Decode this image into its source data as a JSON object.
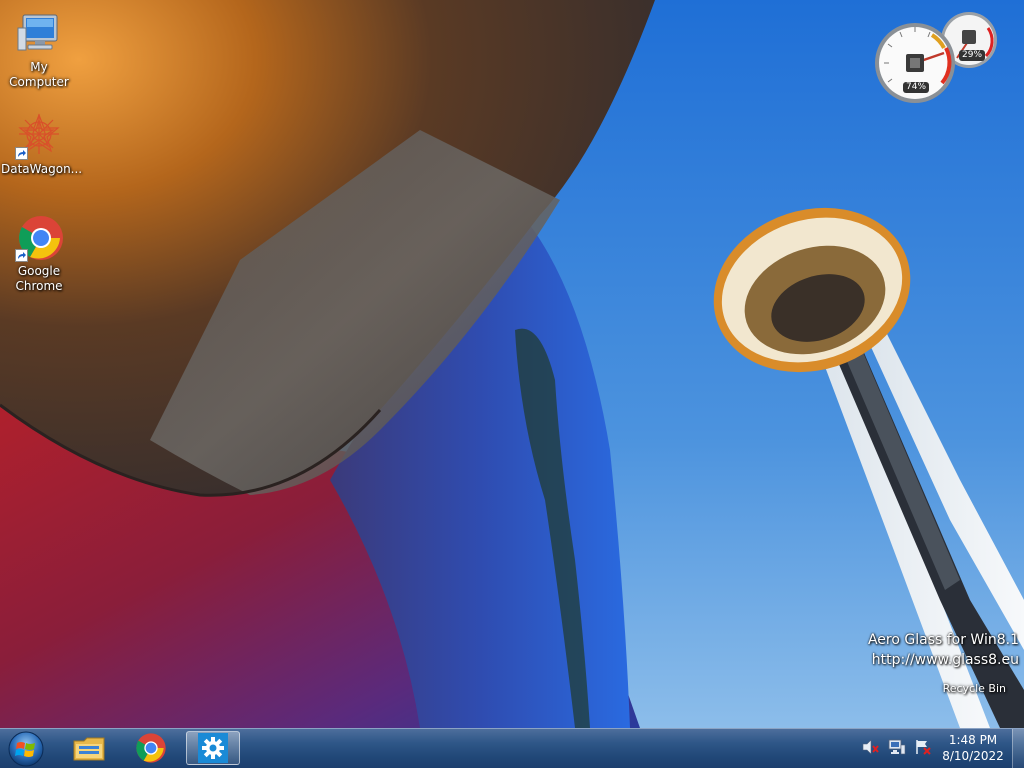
{
  "desktop": {
    "icons": [
      {
        "label": "My Computer",
        "icon": "computer-icon"
      },
      {
        "label": "DataWagon...",
        "icon": "datawagon-icon"
      },
      {
        "label": "Google Chrome",
        "icon": "chrome-icon"
      }
    ],
    "recycle_bin_label": "Recycle Bin"
  },
  "gadget": {
    "cpu_percent_label": "74%",
    "memory_percent_label": "29%",
    "cpu_usage": 0.74,
    "memory_usage": 0.29
  },
  "watermark": {
    "line1": "Aero Glass for Win8.1",
    "line2": "http://www.glass8.eu"
  },
  "taskbar": {
    "start_icon": "windows-start-orb",
    "pinned": [
      {
        "icon": "file-explorer-icon"
      },
      {
        "icon": "chrome-icon"
      },
      {
        "icon": "settings-gear-icon",
        "active": true
      }
    ],
    "tray_icons": [
      "volume-muted-icon",
      "network-icon",
      "action-center-flag-icon"
    ],
    "clock": {
      "time": "1:48 PM",
      "date": "8/10/2022"
    }
  },
  "colors": {
    "sky": "#3f86d8",
    "taskbar": "#214878",
    "building_orange": "#b4661c",
    "building_red": "#9c1f2a"
  }
}
